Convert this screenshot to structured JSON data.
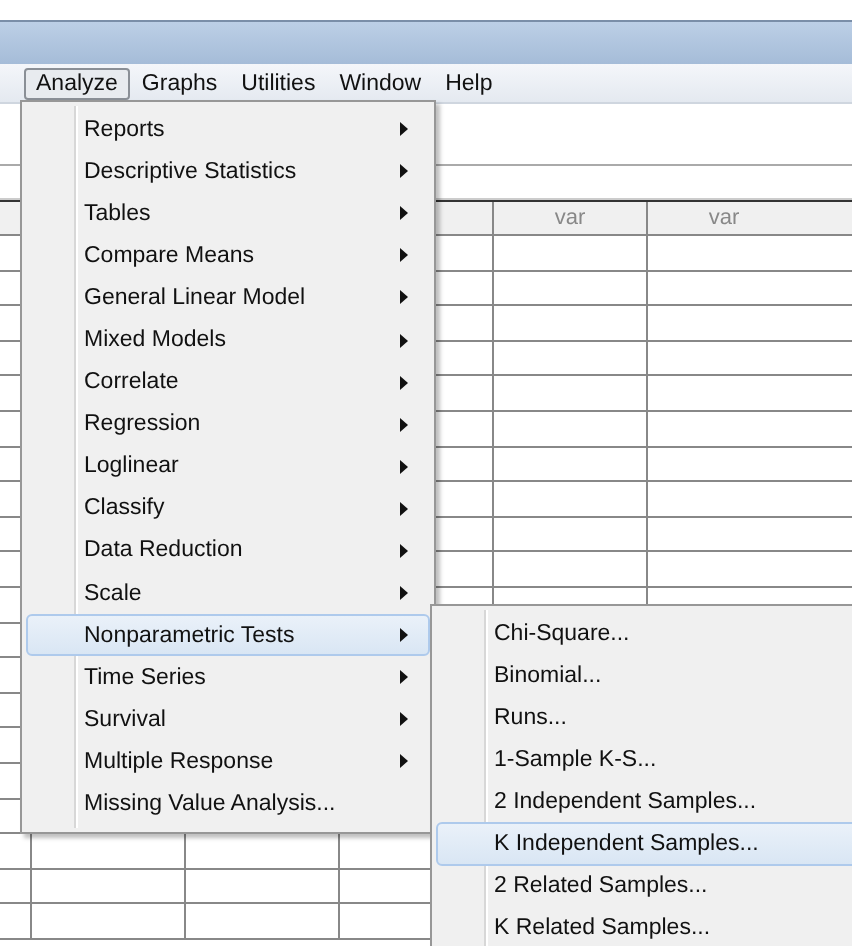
{
  "menubar": [
    {
      "label": "Analyze",
      "selected": true
    },
    {
      "label": "Graphs",
      "selected": false
    },
    {
      "label": "Utilities",
      "selected": false
    },
    {
      "label": "Window",
      "selected": false
    },
    {
      "label": "Help",
      "selected": false
    }
  ],
  "table": {
    "headers": [
      "var",
      "var"
    ]
  },
  "menu": {
    "items": [
      {
        "label": "Reports",
        "submenu": true,
        "selected": false
      },
      {
        "label": "Descriptive Statistics",
        "submenu": true,
        "selected": false
      },
      {
        "label": "Tables",
        "submenu": true,
        "selected": false
      },
      {
        "label": "Compare Means",
        "submenu": true,
        "selected": false
      },
      {
        "label": "General Linear Model",
        "submenu": true,
        "selected": false
      },
      {
        "label": "Mixed Models",
        "submenu": true,
        "selected": false
      },
      {
        "label": "Correlate",
        "submenu": true,
        "selected": false
      },
      {
        "label": "Regression",
        "submenu": true,
        "selected": false
      },
      {
        "label": "Loglinear",
        "submenu": true,
        "selected": false
      },
      {
        "label": "Classify",
        "submenu": true,
        "selected": false
      },
      {
        "label": "Data Reduction",
        "submenu": true,
        "selected": false
      },
      {
        "label": "Scale",
        "submenu": true,
        "selected": false
      },
      {
        "label": "Nonparametric Tests",
        "submenu": true,
        "selected": true
      },
      {
        "label": "Time Series",
        "submenu": true,
        "selected": false
      },
      {
        "label": "Survival",
        "submenu": true,
        "selected": false
      },
      {
        "label": "Multiple Response",
        "submenu": true,
        "selected": false
      },
      {
        "label": "Missing Value Analysis...",
        "submenu": false,
        "selected": false
      }
    ]
  },
  "submenu": {
    "items": [
      {
        "label": "Chi-Square...",
        "selected": false
      },
      {
        "label": "Binomial...",
        "selected": false
      },
      {
        "label": "Runs...",
        "selected": false
      },
      {
        "label": "1-Sample K-S...",
        "selected": false
      },
      {
        "label": "2 Independent Samples...",
        "selected": false
      },
      {
        "label": "K Independent Samples...",
        "selected": true
      },
      {
        "label": "2 Related Samples...",
        "selected": false
      },
      {
        "label": "K Related Samples...",
        "selected": false
      }
    ]
  }
}
